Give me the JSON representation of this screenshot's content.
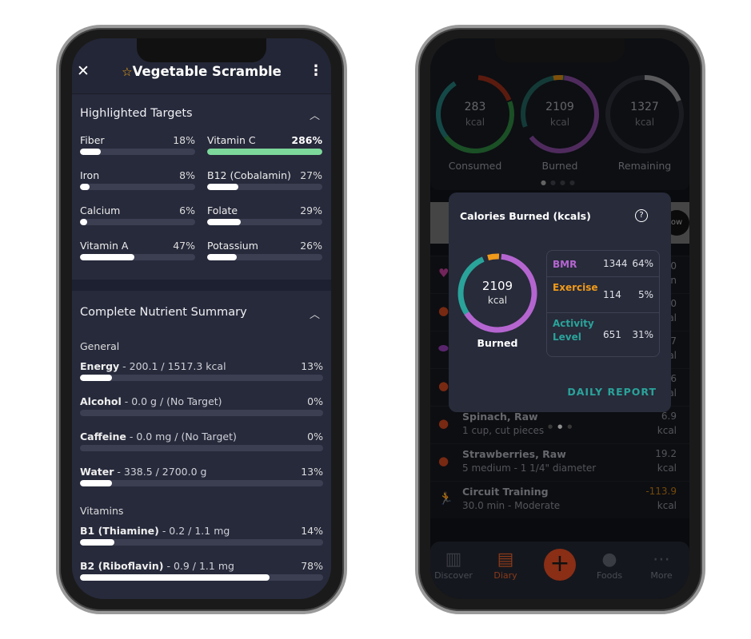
{
  "left_screen": {
    "header": {
      "title": "Vegetable Scramble",
      "close_icon": "close-icon",
      "favorite_icon": "star-outline-icon",
      "menu_icon": "more-vertical-icon"
    },
    "highlighted": {
      "title": "Highlighted Targets",
      "items": [
        {
          "name": "Fiber",
          "pct": "18%",
          "value": 18
        },
        {
          "name": "Vitamin C",
          "pct": "286%",
          "value": 286,
          "color": "#7dd99b"
        },
        {
          "name": "Iron",
          "pct": "8%",
          "value": 8
        },
        {
          "name": "B12 (Cobalamin)",
          "pct": "27%",
          "value": 27
        },
        {
          "name": "Calcium",
          "pct": "6%",
          "value": 6
        },
        {
          "name": "Folate",
          "pct": "29%",
          "value": 29
        },
        {
          "name": "Vitamin A",
          "pct": "47%",
          "value": 47
        },
        {
          "name": "Potassium",
          "pct": "26%",
          "value": 26
        }
      ]
    },
    "summary": {
      "title": "Complete Nutrient Summary",
      "general_label": "General",
      "general": [
        {
          "name": "Energy",
          "detail": " - 200.1 / 1517.3 kcal",
          "pct": "13%",
          "value": 13
        },
        {
          "name": "Alcohol",
          "detail": " - 0.0 g / (No Target)",
          "pct": "0%",
          "value": 0
        },
        {
          "name": "Caffeine",
          "detail": " - 0.0 mg / (No Target)",
          "pct": "0%",
          "value": 0
        },
        {
          "name": "Water",
          "detail": " - 338.5 / 2700.0 g",
          "pct": "13%",
          "value": 13
        }
      ],
      "vitamins_label": "Vitamins",
      "vitamins": [
        {
          "name": "B1 (Thiamine)",
          "detail": " - 0.2 / 1.1 mg",
          "pct": "14%",
          "value": 14
        },
        {
          "name": "B2 (Riboflavin)",
          "detail": " - 0.9 / 1.1 mg",
          "pct": "78%",
          "value": 78
        }
      ]
    }
  },
  "right_screen": {
    "rings": [
      {
        "value": "283",
        "unit": "kcal",
        "label": "Consumed"
      },
      {
        "value": "2109",
        "unit": "kcal",
        "label": "Burned"
      },
      {
        "value": "1327",
        "unit": "kcal",
        "label": "Remaining"
      }
    ],
    "list": [
      {
        "name": "",
        "sub": "",
        "val": "0",
        "unit": "n",
        "icon": "heart-rate-icon"
      },
      {
        "name": "",
        "sub": "",
        "val": "0",
        "unit": "al",
        "icon": "apple-icon"
      },
      {
        "name": "",
        "sub": "",
        "val": "7",
        "unit": "al",
        "icon": "pill-icon"
      },
      {
        "name": "",
        "sub": "",
        "val": "6",
        "unit": "al",
        "icon": "apple-icon"
      },
      {
        "name": "Spinach, Raw",
        "sub": "1 cup, cut pieces",
        "val": "6.9",
        "unit": "kcal",
        "icon": "apple-icon"
      },
      {
        "name": "Strawberries, Raw",
        "sub": "5 medium - 1 1/4\" diameter",
        "val": "19.2",
        "unit": "kcal",
        "icon": "apple-icon"
      },
      {
        "name": "Circuit Training",
        "sub": "30.0 min - Moderate",
        "val": "-113.9",
        "unit": "kcal",
        "icon": "running-icon"
      }
    ],
    "ad_fragment": "ow",
    "popup": {
      "title": "Calories Burned (kcals)",
      "value": "2109",
      "unit": "kcal",
      "label": "Burned",
      "rows": [
        {
          "name": "BMR",
          "kcal": "1344",
          "pct": "64%",
          "color": "#b565d0"
        },
        {
          "name": "Exercise",
          "kcal": "114",
          "pct": "5%",
          "color": "#f09a1a"
        },
        {
          "name": "Activity Level",
          "kcal": "651",
          "pct": "31%",
          "color": "#2aa39a"
        }
      ],
      "action": "DAILY REPORT"
    },
    "nav": [
      {
        "label": "Discover",
        "icon": "chart-icon"
      },
      {
        "label": "Diary",
        "icon": "diary-icon",
        "active": true
      },
      {
        "label": "",
        "icon": "plus-icon"
      },
      {
        "label": "Foods",
        "icon": "apple-icon"
      },
      {
        "label": "More",
        "icon": "more-icon"
      }
    ],
    "accent": "#c8451f"
  }
}
